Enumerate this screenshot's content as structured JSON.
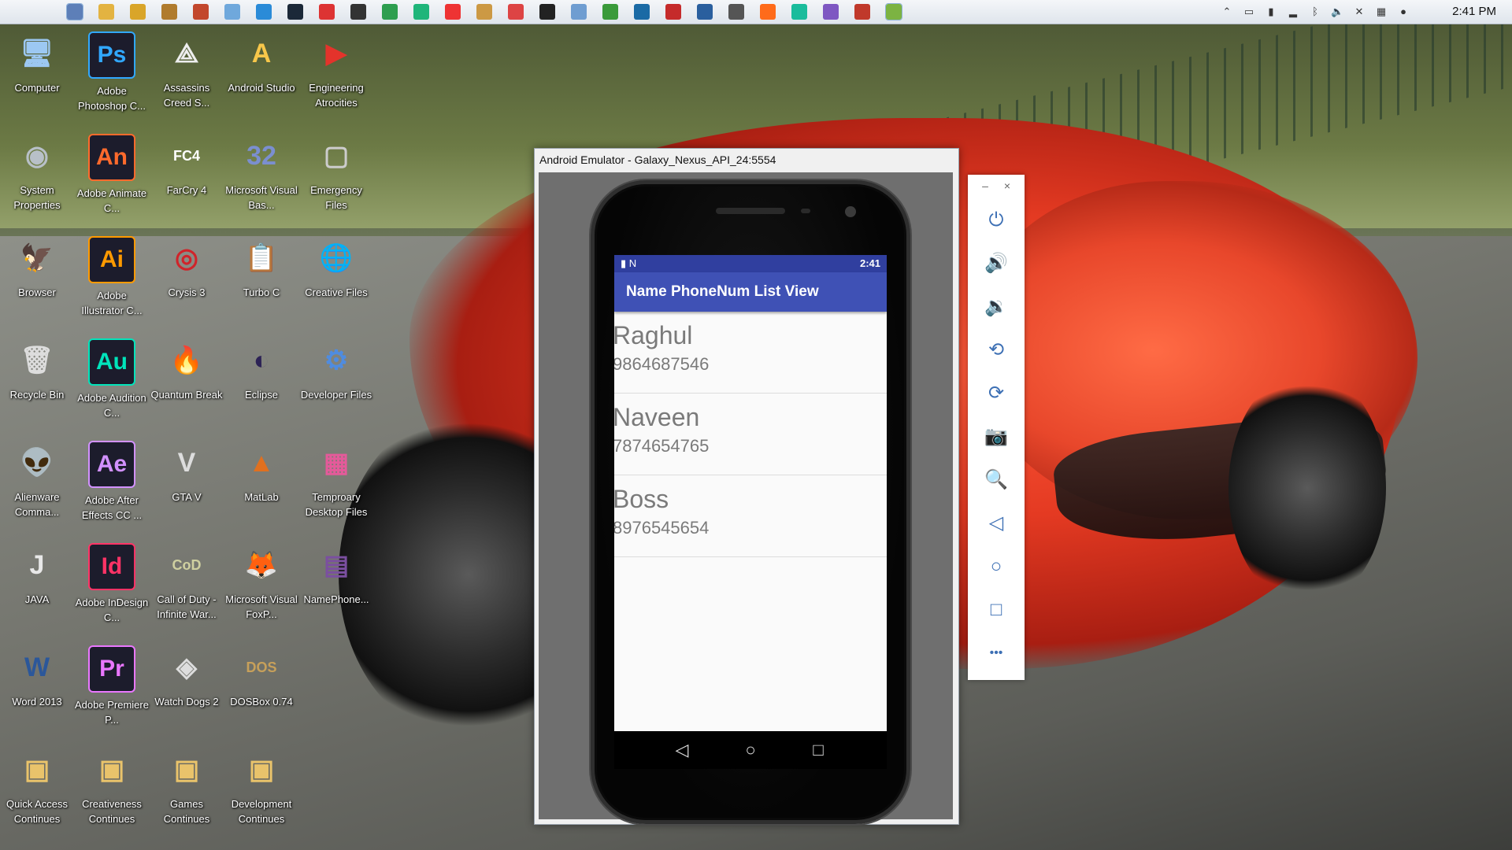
{
  "taskbar": {
    "clock": "2:41 PM",
    "pinned_icons": [
      "finder-icon",
      "explorer-icon",
      "paint-icon",
      "winrar-icon",
      "app-icon",
      "cloud-icon",
      "chrome-icon",
      "steam-icon",
      "mail-icon",
      "settings-icon",
      "excel-icon",
      "pycharm-icon",
      "download-icon",
      "gift-icon",
      "pdf-icon",
      "monitor-icon",
      "app2-icon",
      "chrome2-icon",
      "atom-icon",
      "acrobat-icon",
      "box-icon",
      "database-icon",
      "tool-icon",
      "infinity-icon",
      "purple-icon",
      "flag-icon",
      "android-icon"
    ],
    "tray_icons": [
      "chevron-up-icon",
      "monitor-icon",
      "battery-icon",
      "signal-icon",
      "bluetooth-icon",
      "volume-icon",
      "mute-icon",
      "network-icon",
      "globe-icon"
    ]
  },
  "desktop": {
    "icons": [
      {
        "label": "Computer",
        "glyph": "🖥",
        "color": "#9cc8f2"
      },
      {
        "label": "Adobe Photoshop C...",
        "glyph": "Ps",
        "color": "#31a8ff"
      },
      {
        "label": "Assassins Creed S...",
        "glyph": "⟁",
        "color": "#eee"
      },
      {
        "label": "Android Studio",
        "glyph": "A",
        "color": "#f7c74a"
      },
      {
        "label": "Engineering Atrocities",
        "glyph": "▶",
        "color": "#e4332b"
      },
      {
        "label": "System Properties",
        "glyph": "◉",
        "color": "#b8c0c8"
      },
      {
        "label": "Adobe Animate C...",
        "glyph": "An",
        "color": "#ff6a2c"
      },
      {
        "label": "FarCry 4",
        "glyph": "FC4",
        "color": "#fff"
      },
      {
        "label": "Microsoft Visual Bas...",
        "glyph": "32",
        "color": "#7b8fd0"
      },
      {
        "label": "Emergency Files",
        "glyph": "▢",
        "color": "#ccc"
      },
      {
        "label": "Browser",
        "glyph": "🦅",
        "color": "#cfe4f7"
      },
      {
        "label": "Adobe Illustrator C...",
        "glyph": "Ai",
        "color": "#ff9a00"
      },
      {
        "label": "Crysis 3",
        "glyph": "◎",
        "color": "#d0242a"
      },
      {
        "label": "Turbo C",
        "glyph": "📋",
        "color": "#eee"
      },
      {
        "label": "Creative Files",
        "glyph": "🌐",
        "color": "#5ea2ff"
      },
      {
        "label": "Recycle Bin",
        "glyph": "🗑",
        "color": "#ddd"
      },
      {
        "label": "Adobe Audition C...",
        "glyph": "Au",
        "color": "#00e4bb"
      },
      {
        "label": "Quantum Break",
        "glyph": "🔥",
        "color": "#ff8a1a"
      },
      {
        "label": "Eclipse",
        "glyph": "◐",
        "color": "#2c2255"
      },
      {
        "label": "Developer Files",
        "glyph": "⚙",
        "color": "#4f8ce0"
      },
      {
        "label": "Alienware Comma...",
        "glyph": "👽",
        "color": "#ccc"
      },
      {
        "label": "Adobe After Effects CC ...",
        "glyph": "Ae",
        "color": "#d291ff"
      },
      {
        "label": "GTA V",
        "glyph": "V",
        "color": "#ddd"
      },
      {
        "label": "MatLab",
        "glyph": "▲",
        "color": "#e0701f"
      },
      {
        "label": "Temproary Desktop Files",
        "glyph": "▦",
        "color": "#e45a9a"
      },
      {
        "label": "JAVA",
        "glyph": "J",
        "color": "#e8e8e8"
      },
      {
        "label": "Adobe InDesign C...",
        "glyph": "Id",
        "color": "#ff3366"
      },
      {
        "label": "Call of Duty - Infinite War...",
        "glyph": "CoD",
        "color": "#cfd0a0"
      },
      {
        "label": "Microsoft Visual FoxP...",
        "glyph": "🦊",
        "color": "#e8691f"
      },
      {
        "label": "NamePhone...",
        "glyph": "▤",
        "color": "#7b4fa0"
      },
      {
        "label": "Word 2013",
        "glyph": "W",
        "color": "#2b579a"
      },
      {
        "label": "Adobe Premiere P...",
        "glyph": "Pr",
        "color": "#ea77ff"
      },
      {
        "label": "Watch Dogs 2",
        "glyph": "◈",
        "color": "#ddd"
      },
      {
        "label": "DOSBox 0.74",
        "glyph": "DOS",
        "color": "#c7a05a"
      },
      {
        "label": "Quick Access Continues",
        "glyph": "▣",
        "color": "#e9c36b"
      },
      {
        "label": "Creativeness Continues",
        "glyph": "▣",
        "color": "#e9c36b"
      },
      {
        "label": "Games Continues",
        "glyph": "▣",
        "color": "#e9c36b"
      },
      {
        "label": "Development Continues",
        "glyph": "▣",
        "color": "#e9c36b"
      }
    ]
  },
  "emulator": {
    "window_title": "Android Emulator - Galaxy_Nexus_API_24:5554",
    "status_bar": {
      "left_icons": "▮ N",
      "right": "2:41"
    },
    "app_title": "Name PhoneNum List View",
    "contacts": [
      {
        "name": "Raghul",
        "phone": "9864687546"
      },
      {
        "name": "Naveen",
        "phone": "7874654765"
      },
      {
        "name": "Boss",
        "phone": "8976545654"
      }
    ],
    "nav_icons": [
      "back-icon",
      "home-icon",
      "recents-icon"
    ],
    "toolbar": {
      "minimize": "–",
      "close": "×",
      "buttons": [
        {
          "name": "power-icon",
          "glyph": "⏻"
        },
        {
          "name": "volume-up-icon",
          "glyph": "🔊"
        },
        {
          "name": "volume-down-icon",
          "glyph": "🔉"
        },
        {
          "name": "rotate-left-icon",
          "glyph": "⟲"
        },
        {
          "name": "rotate-right-icon",
          "glyph": "⟳"
        },
        {
          "name": "camera-icon",
          "glyph": "📷"
        },
        {
          "name": "zoom-icon",
          "glyph": "🔍"
        },
        {
          "name": "back-icon",
          "glyph": "◁"
        },
        {
          "name": "home-icon",
          "glyph": "○"
        },
        {
          "name": "overview-icon",
          "glyph": "□"
        },
        {
          "name": "more-icon",
          "glyph": "•••"
        }
      ]
    }
  }
}
